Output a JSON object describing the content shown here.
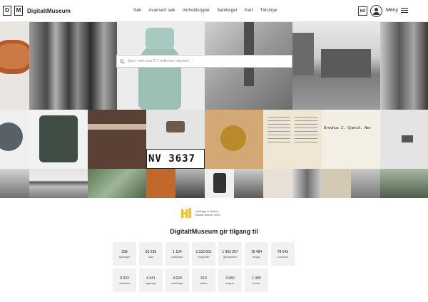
{
  "header": {
    "logo_letters": [
      "D",
      "M"
    ],
    "logo_text": "DigitaltMuseum",
    "nav": [
      "Søk",
      "Avansert søk",
      "Innholdstyper",
      "Samlinger",
      "Kart",
      "Tidslinje"
    ],
    "language": "NO",
    "menu_label": "Meny"
  },
  "search": {
    "placeholder": "Søk i mer enn 5.7 millioner objekter"
  },
  "mosaic": {
    "plate_text": "NV 3637",
    "document_text": "Brevhus I. Gjøvik. Ner"
  },
  "award": {
    "line1": "Heritage in Motion",
    "line2": "Award Winner 2019"
  },
  "headline": "DigitaltMuseum gir tilgang til",
  "stats": [
    {
      "num": "298",
      "label": "samlinger"
    },
    {
      "num": "82 299",
      "label": "navn"
    },
    {
      "num": "1 104",
      "label": "utstillinger"
    },
    {
      "num": "3 333 601",
      "label": "fotografier"
    },
    {
      "num": "1 953 267",
      "label": "gjenstander"
    },
    {
      "num": "78 484",
      "label": "design"
    },
    {
      "num": "78 643",
      "label": "kunstverk"
    },
    {
      "num": "9 023",
      "label": "arkitektur"
    },
    {
      "num": "4 341",
      "label": "bygninger"
    },
    {
      "num": "4 629",
      "label": "fortellinger"
    },
    {
      "num": "610",
      "label": "artikler"
    },
    {
      "num": "4 942",
      "label": "mapper"
    },
    {
      "num": "1 089",
      "label": "medier"
    }
  ],
  "colors": {
    "accent": "#f2c12e"
  }
}
